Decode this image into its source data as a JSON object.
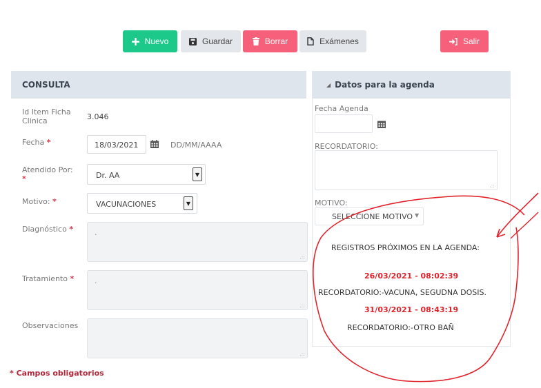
{
  "toolbar": {
    "nuevo": "Nuevo",
    "guardar": "Guardar",
    "borrar": "Borrar",
    "examenes": "Exámenes",
    "salir": "Salir"
  },
  "consulta": {
    "title": "CONSULTA",
    "id_label": "Id Item Ficha Clinica",
    "id_value": "3.046",
    "fecha_label": "Fecha",
    "fecha_value": "18/03/2021",
    "fecha_format": "DD/MM/AAAA",
    "atendido_label": "Atendido Por:",
    "atendido_value": "Dr. AA",
    "motivo_label": "Motivo:",
    "motivo_value": "VACUNACIONES",
    "diagnostico_label": "Diagnóstico",
    "diagnostico_value": ".",
    "tratamiento_label": "Tratamiento",
    "tratamiento_value": ".",
    "observaciones_label": "Observaciones",
    "required_mark": "*"
  },
  "agenda": {
    "title": "Datos para la agenda",
    "fecha_label": "Fecha Agenda",
    "recordatorio_label": "RECORDATORIO:",
    "motivo_label": "MOTIVO:",
    "motivo_select": "SELECCIONE MOTIVO",
    "proximos_title": "REGISTROS PRÓXIMOS EN LA AGENDA:",
    "entries": [
      {
        "datetime": "26/03/2021 - 08:02:39",
        "text": "RECORDATORIO:-VACUNA, SEGUDNA DOSIS."
      },
      {
        "datetime": "31/03/2021 - 08:43:19",
        "text": "RECORDATORIO:-OTRO BAÑ"
      }
    ]
  },
  "footer": {
    "required_note": "* Campos obligatorios"
  },
  "colors": {
    "success": "#1cc88a",
    "danger": "#f6607a",
    "annotation": "#e0232c"
  }
}
